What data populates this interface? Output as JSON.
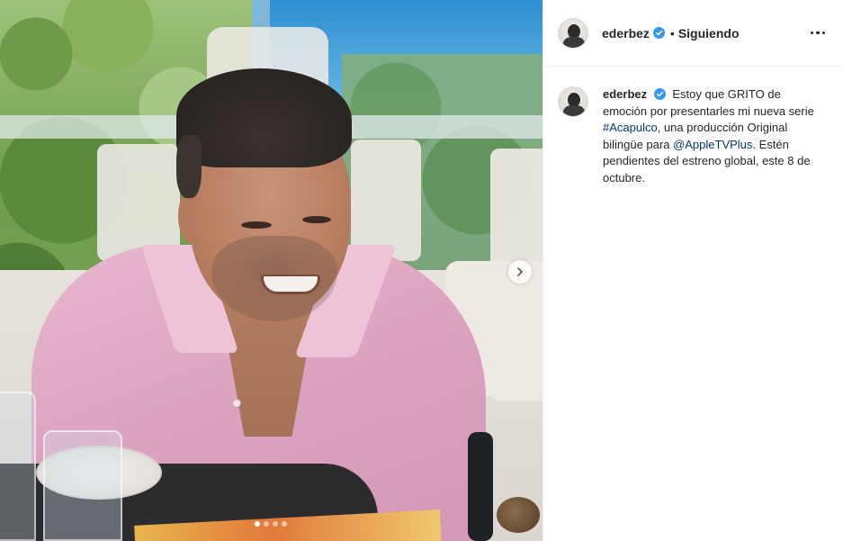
{
  "post": {
    "media": {
      "carousel_dots": [
        true,
        false,
        false,
        false
      ],
      "next_icon": "chevron-right-icon"
    },
    "header": {
      "username": "ederbez",
      "verified_icon": "verified-badge-icon",
      "separator": "•",
      "follow_status": "Siguiendo",
      "more_icon": "more-horizontal-icon"
    },
    "caption": {
      "username": "ederbez",
      "text_1": " Estoy que GRITO de emoción por presentarles mi nueva serie ",
      "hashtag": "#Acapulco",
      "text_2": ", una producción Original bilingüe para ",
      "mention": "@AppleTVPlus",
      "text_3": ". Estén pendientes del estreno global, este 8 de octubre."
    },
    "colors": {
      "verified": "#3897f0",
      "link": "#00376b",
      "text": "#262626",
      "border": "#efefef"
    }
  }
}
